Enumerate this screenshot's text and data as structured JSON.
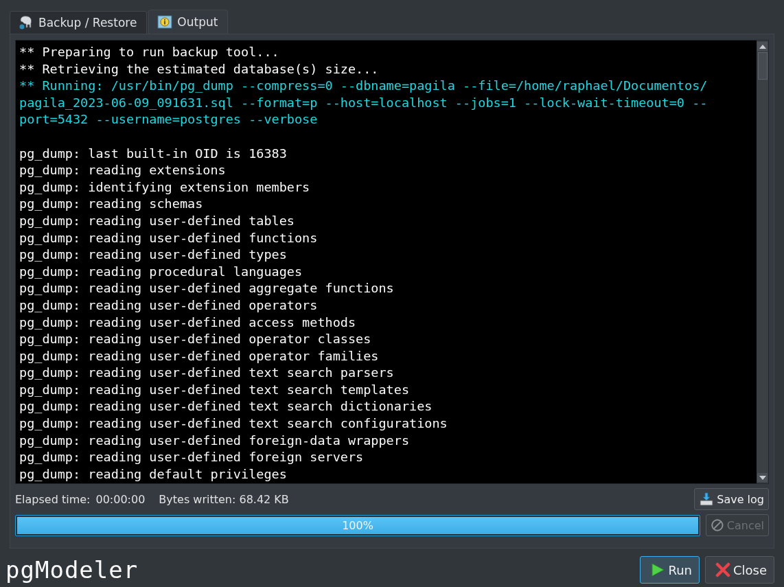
{
  "tabs": [
    {
      "label": "Backup / Restore",
      "kind": "elephant",
      "selected": false
    },
    {
      "label": "Output",
      "kind": "info",
      "selected": true
    }
  ],
  "log": [
    {
      "kind": "normal",
      "text": "** Preparing to run backup tool..."
    },
    {
      "kind": "normal",
      "text": "** Retrieving the estimated database(s) size..."
    },
    {
      "kind": "command",
      "text": "** Running: /usr/bin/pg_dump --compress=0 --dbname=pagila --file=/home/raphael/Documentos/"
    },
    {
      "kind": "command",
      "text": "pagila_2023-06-09_091631.sql --format=p --host=localhost --jobs=1 --lock-wait-timeout=0 --"
    },
    {
      "kind": "command",
      "text": "port=5432 --username=postgres --verbose"
    },
    {
      "kind": "blank"
    },
    {
      "kind": "normal",
      "text": "pg_dump: last built-in OID is 16383"
    },
    {
      "kind": "normal",
      "text": "pg_dump: reading extensions"
    },
    {
      "kind": "normal",
      "text": "pg_dump: identifying extension members"
    },
    {
      "kind": "normal",
      "text": "pg_dump: reading schemas"
    },
    {
      "kind": "normal",
      "text": "pg_dump: reading user-defined tables"
    },
    {
      "kind": "normal",
      "text": "pg_dump: reading user-defined functions"
    },
    {
      "kind": "normal",
      "text": "pg_dump: reading user-defined types"
    },
    {
      "kind": "normal",
      "text": "pg_dump: reading procedural languages"
    },
    {
      "kind": "normal",
      "text": "pg_dump: reading user-defined aggregate functions"
    },
    {
      "kind": "normal",
      "text": "pg_dump: reading user-defined operators"
    },
    {
      "kind": "normal",
      "text": "pg_dump: reading user-defined access methods"
    },
    {
      "kind": "normal",
      "text": "pg_dump: reading user-defined operator classes"
    },
    {
      "kind": "normal",
      "text": "pg_dump: reading user-defined operator families"
    },
    {
      "kind": "normal",
      "text": "pg_dump: reading user-defined text search parsers"
    },
    {
      "kind": "normal",
      "text": "pg_dump: reading user-defined text search templates"
    },
    {
      "kind": "normal",
      "text": "pg_dump: reading user-defined text search dictionaries"
    },
    {
      "kind": "normal",
      "text": "pg_dump: reading user-defined text search configurations"
    },
    {
      "kind": "normal",
      "text": "pg_dump: reading user-defined foreign-data wrappers"
    },
    {
      "kind": "normal",
      "text": "pg_dump: reading user-defined foreign servers"
    },
    {
      "kind": "normal",
      "text": "pg_dump: reading default privileges"
    }
  ],
  "status": {
    "elapsed_label": "Elapsed time:",
    "elapsed": "00:00:00",
    "bytes": "Bytes written: 68.42 KB"
  },
  "save_log": {
    "label": "Save log",
    "disabled": false
  },
  "progress": {
    "level": 1.0,
    "text": "100%"
  },
  "cancel": {
    "label": "Cancel",
    "disabled": true
  },
  "logo": "pgModeler",
  "buttons": [
    {
      "label": "Run",
      "kind": "play",
      "selected": true
    },
    {
      "label": "Close",
      "kind": "x",
      "selected": false
    }
  ]
}
